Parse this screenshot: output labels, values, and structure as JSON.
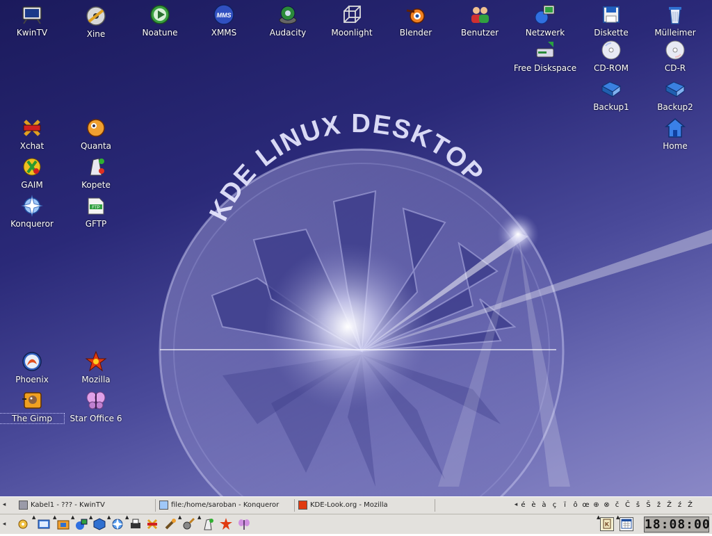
{
  "desktop": {
    "wallpaper_text": "KDE LINUX DESKTOP",
    "icons": [
      {
        "label": "KwinTV",
        "icon": "tv-icon"
      },
      {
        "label": "Xine",
        "icon": "film-reel-icon"
      },
      {
        "label": "Noatune",
        "icon": "play-icon"
      },
      {
        "label": "XMMS",
        "icon": "xmms-icon"
      },
      {
        "label": "Audacity",
        "icon": "speaker-icon"
      },
      {
        "label": "Moonlight",
        "icon": "wireframe-cube-icon"
      },
      {
        "label": "Blender",
        "icon": "blender-icon"
      },
      {
        "label": "Benutzer",
        "icon": "users-icon"
      },
      {
        "label": "Netzwerk",
        "icon": "network-icon"
      },
      {
        "label": "Diskette",
        "icon": "floppy-icon"
      },
      {
        "label": "Mülleimer",
        "icon": "trash-icon"
      },
      {
        "label": "Free Diskspace",
        "icon": "disk-free-icon"
      },
      {
        "label": "CD-ROM",
        "icon": "cdrom-icon"
      },
      {
        "label": "CD-R",
        "icon": "cdr-icon"
      },
      {
        "label": "Backup1",
        "icon": "folder-backup-icon"
      },
      {
        "label": "Backup2",
        "icon": "folder-backup-icon"
      },
      {
        "label": "Home",
        "icon": "home-icon"
      },
      {
        "label": "Xchat",
        "icon": "xchat-icon"
      },
      {
        "label": "Quanta",
        "icon": "quanta-icon"
      },
      {
        "label": "GAIM",
        "icon": "gaim-icon"
      },
      {
        "label": "Kopete",
        "icon": "kopete-icon"
      },
      {
        "label": "Konqueror",
        "icon": "konqueror-icon"
      },
      {
        "label": "GFTP",
        "icon": "ftp-icon"
      },
      {
        "label": "Phoenix",
        "icon": "phoenix-icon"
      },
      {
        "label": "Mozilla",
        "icon": "mozilla-icon"
      },
      {
        "label": "The Gimp",
        "icon": "gimp-icon"
      },
      {
        "label": "Star Office 6",
        "icon": "butterfly-icon"
      }
    ]
  },
  "taskbar": {
    "tasks": [
      {
        "label": "Kabel1 - ??? - KwinTV"
      },
      {
        "label": "file:/home/saroban - Konqueror"
      },
      {
        "label": "KDE-Look.org - Mozilla"
      }
    ],
    "special_chars": [
      "é",
      "è",
      "à",
      "ç",
      "ï",
      "ô",
      "œ",
      "⊕",
      "⊗",
      "č",
      "Č",
      "š",
      "Š",
      "ž",
      "Ž",
      "ź",
      "Ž"
    ],
    "clock": "18:08:00"
  },
  "colors": {
    "desktop_dark": "#1b1a5c",
    "desktop_light": "#8a88c6",
    "panel_bg": "#e3e1dd"
  }
}
